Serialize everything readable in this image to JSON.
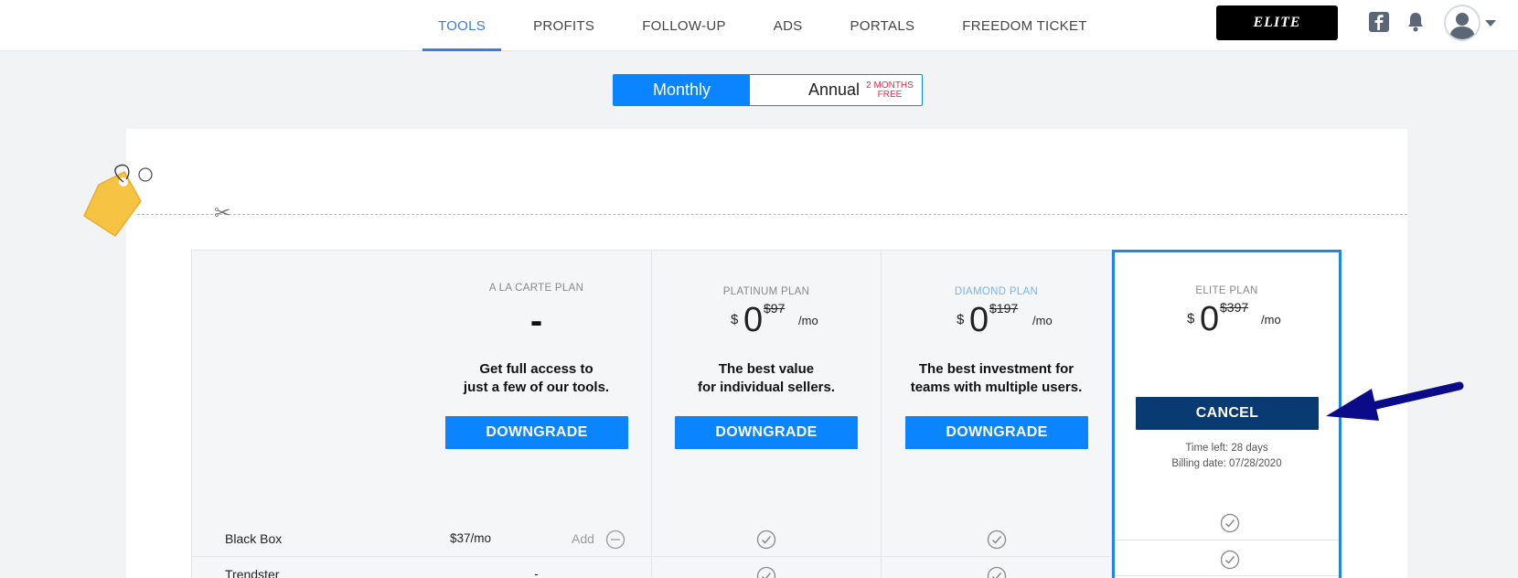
{
  "nav": {
    "items": [
      {
        "label": "TOOLS",
        "active": true
      },
      {
        "label": "PROFITS"
      },
      {
        "label": "FOLLOW-UP"
      },
      {
        "label": "ADS"
      },
      {
        "label": "PORTALS"
      },
      {
        "label": "FREEDOM TICKET"
      }
    ],
    "elite_label": "ELITE"
  },
  "billing_toggle": {
    "monthly": "Monthly",
    "annual": "Annual",
    "annual_promo_line1": "2 MONTHS",
    "annual_promo_line2": "FREE",
    "selected": "Monthly"
  },
  "plans": [
    {
      "name": "A LA CARTE PLAN",
      "price_placeholder": "-",
      "desc_line1": "Get full access to",
      "desc_line2": "just a few of our tools.",
      "button": "DOWNGRADE"
    },
    {
      "name": "PLATINUM PLAN",
      "currency": "$",
      "price": "0",
      "old_price": "$97",
      "per": "/mo",
      "desc_line1": "The best value",
      "desc_line2": "for individual sellers.",
      "button": "DOWNGRADE"
    },
    {
      "name": "DIAMOND PLAN",
      "currency": "$",
      "price": "0",
      "old_price": "$197",
      "per": "/mo",
      "desc_line1": "The best investment for",
      "desc_line2": "teams with multiple users.",
      "button": "DOWNGRADE"
    },
    {
      "name": "ELITE PLAN",
      "currency": "$",
      "price": "0",
      "old_price": "$397",
      "per": "/mo",
      "button": "CANCEL",
      "time_left": "Time left: 28 days",
      "billing_date": "Billing date: 07/28/2020"
    }
  ],
  "features": [
    {
      "name": "Black Box",
      "alacarte_price": "$37/mo",
      "alacarte_action": "Add"
    },
    {
      "name": "Trendster",
      "alacarte_price": "-"
    }
  ],
  "colors": {
    "accent": "#0a84ff",
    "cancel": "#093a72",
    "elite_border": "#1f85e6",
    "promo": "#d9304b",
    "arrow": "#0b0b8a"
  }
}
